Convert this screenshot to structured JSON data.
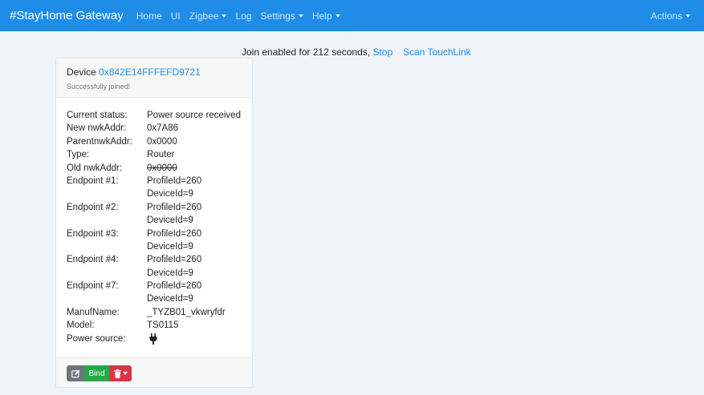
{
  "navbar": {
    "brand": "#StayHome Gateway",
    "items": [
      {
        "label": "Home"
      },
      {
        "label": "UI"
      },
      {
        "label": "Zigbee"
      },
      {
        "label": "Log"
      },
      {
        "label": "Settings"
      },
      {
        "label": "Help"
      }
    ],
    "actions_label": "Actions"
  },
  "join": {
    "text": "Join enabled for 212 seconds,",
    "stop_label": "Stop",
    "scan_label": "Scan TouchLink"
  },
  "device": {
    "title_prefix": "Device",
    "address": "0x842E14FFFEFD9721",
    "subtitle": "Successfully joined!",
    "rows": [
      {
        "k": "Current status:",
        "v": "Power source received"
      },
      {
        "k": "New nwkAddr:",
        "v": "0x7A86"
      },
      {
        "k": "ParentnwkAddr:",
        "v": "0x0000"
      },
      {
        "k": "Type:",
        "v": "Router"
      },
      {
        "k": "Old nwkAddr:",
        "v": "0x0000"
      },
      {
        "k": "Endpoint #1:",
        "v": "ProfileId=260"
      },
      {
        "k": "",
        "v": "DeviceId=9"
      },
      {
        "k": "Endpoint #2:",
        "v": "ProfileId=260"
      },
      {
        "k": "",
        "v": "DeviceId=9"
      },
      {
        "k": "Endpoint #3:",
        "v": "ProfileId=260"
      },
      {
        "k": "",
        "v": "DeviceId=9"
      },
      {
        "k": "Endpoint #4:",
        "v": "ProfileId=260"
      },
      {
        "k": "",
        "v": "DeviceId=9"
      },
      {
        "k": "Endpoint #7:",
        "v": "ProfileId=260"
      },
      {
        "k": "",
        "v": "DeviceId=9"
      },
      {
        "k": "ManufName:",
        "v": "_TYZB01_vkwryfdr"
      },
      {
        "k": "Model:",
        "v": "TS0115"
      }
    ],
    "power_source_label": "Power source:",
    "power_source_icon": "plug-icon",
    "buttons": {
      "edit_icon": "edit-icon",
      "bind_label": "Bind",
      "delete_icon": "trash-icon"
    }
  },
  "colors": {
    "navbar": "#1f8ce8",
    "link": "#1f8ce8",
    "bind": "#28a745",
    "delete": "#dc3545",
    "edit": "#6c757d"
  }
}
